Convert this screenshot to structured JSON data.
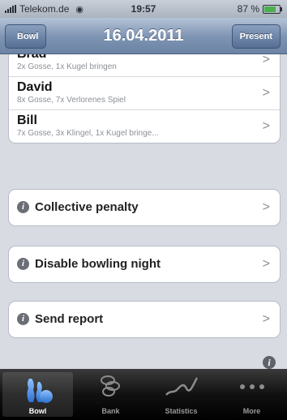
{
  "status": {
    "carrier": "Telekom.de",
    "time": "19:57",
    "battery": "87 %",
    "battery_level": 0.87
  },
  "nav": {
    "title": "16.04.2011",
    "back_label": "Bowl",
    "right_label": "Present"
  },
  "players": [
    {
      "name": "Brad",
      "detail": "2x Gosse, 1x Kugel bringen"
    },
    {
      "name": "David",
      "detail": "8x Gosse, 7x Verlorenes Spiel"
    },
    {
      "name": "Bill",
      "detail": "7x Gosse, 3x Klingel, 1x Kugel bringe..."
    }
  ],
  "actions": [
    {
      "label": "Collective penalty"
    },
    {
      "label": "Disable bowling night"
    },
    {
      "label": "Send report"
    }
  ],
  "tabs": [
    {
      "label": "Bowl",
      "icon": "bowling-pins-icon"
    },
    {
      "label": "Bank",
      "icon": "coins-icon"
    },
    {
      "label": "Statistics",
      "icon": "chart-line-icon"
    },
    {
      "label": "More",
      "icon": "more-dots-icon"
    }
  ],
  "colors": {
    "nav_bar": "#7d93b2",
    "tab_bar": "#111111",
    "active_tab_icon": "#4b8fe0"
  }
}
